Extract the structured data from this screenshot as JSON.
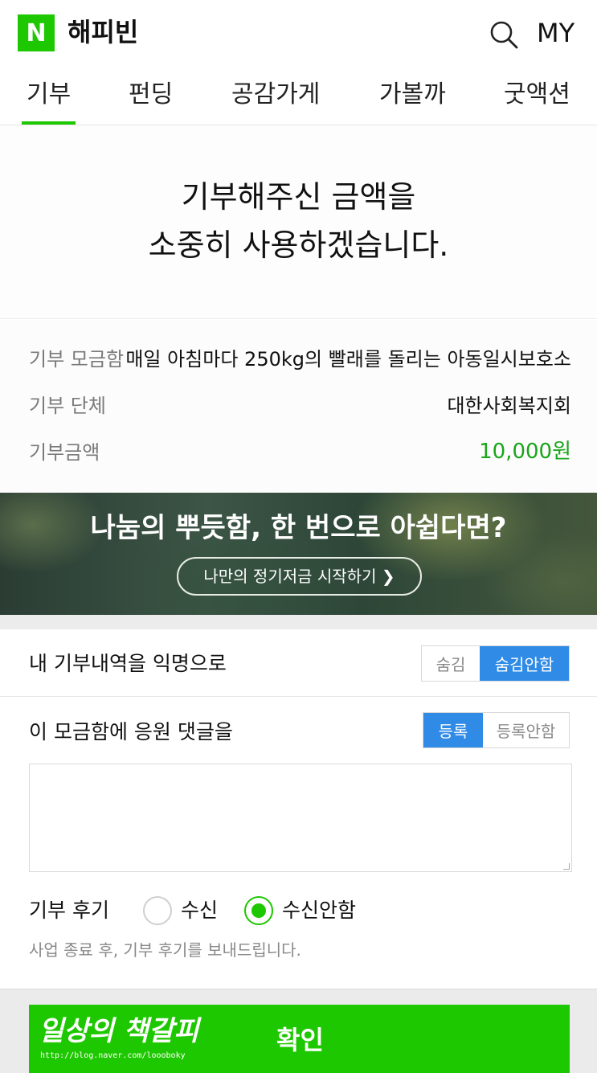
{
  "header": {
    "logo_letter": "N",
    "brand": "해피빈",
    "search_icon": "search-icon",
    "my_label": "MY"
  },
  "tabs": [
    {
      "label": "기부",
      "active": true
    },
    {
      "label": "펀딩",
      "active": false
    },
    {
      "label": "공감가게",
      "active": false
    },
    {
      "label": "가볼까",
      "active": false
    },
    {
      "label": "굿액션",
      "active": false
    }
  ],
  "hero": {
    "line1": "기부해주신 금액을",
    "line2": "소중히 사용하겠습니다."
  },
  "info": {
    "fund_label": "기부 모금함",
    "fund_value": "매일 아침마다 250kg의 빨래를 돌리는 아동일시보호소",
    "org_label": "기부 단체",
    "org_value": "대한사회복지회",
    "amount_label": "기부금액",
    "amount_value": "10,000원"
  },
  "banner": {
    "title": "나눔의 뿌듯함, 한 번으로 아쉽다면?",
    "button": "나만의 정기저금 시작하기 ❯"
  },
  "anonymous": {
    "label": "내 기부내역을 익명으로",
    "options": [
      "숨김",
      "숨김안함"
    ],
    "selected": "숨김안함"
  },
  "comment": {
    "label": "이 모금함에 응원 댓글을",
    "options": [
      "등록",
      "등록안함"
    ],
    "selected": "등록",
    "text": ""
  },
  "review": {
    "label": "기부 후기",
    "options": [
      "수신",
      "수신안함"
    ],
    "selected": "수신안함",
    "note": "사업 종료 후, 기부 후기를 보내드립니다."
  },
  "footer": {
    "confirm": "확인",
    "watermark": "일상의 책갈피",
    "watermark_url": "http://blog.naver.com/loooboky"
  },
  "colors": {
    "naver_green": "#1ec800",
    "amount_green": "#1aa51a",
    "selected_blue": "#2f8be6"
  }
}
